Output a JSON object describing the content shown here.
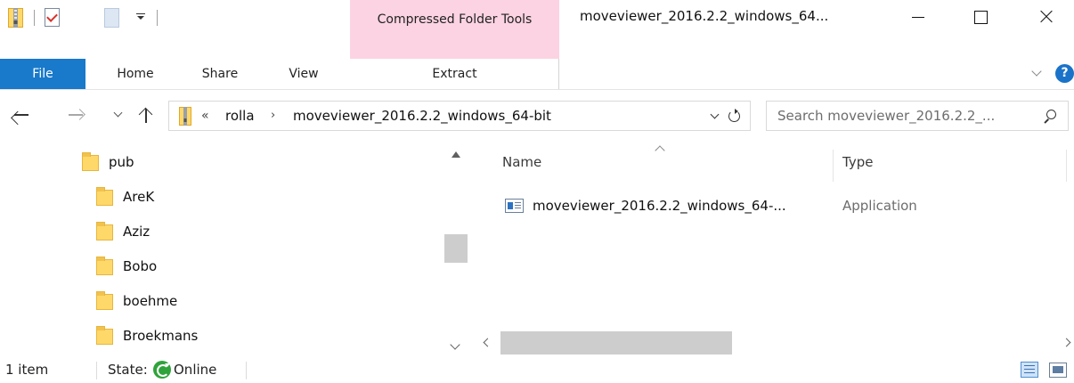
{
  "window": {
    "title": "moveviewer_2016.2.2_windows_64...",
    "context_tab_group": "Compressed Folder Tools"
  },
  "ribbon": {
    "tabs": [
      {
        "label": "File",
        "active": true
      },
      {
        "label": "Home"
      },
      {
        "label": "Share"
      },
      {
        "label": "View"
      },
      {
        "label": "Extract"
      }
    ],
    "help": "?"
  },
  "address_bar": {
    "overflow_chevron": "«",
    "crumbs": [
      "rolla",
      "moveviewer_2016.2.2_windows_64-bit"
    ],
    "separator": "›"
  },
  "search": {
    "placeholder": "Search moveviewer_2016.2.2_..."
  },
  "navigation_pane": {
    "items": [
      {
        "label": "pub",
        "level": 0
      },
      {
        "label": "AreK",
        "level": 1
      },
      {
        "label": "Aziz",
        "level": 1
      },
      {
        "label": "Bobo",
        "level": 1
      },
      {
        "label": "boehme",
        "level": 1
      },
      {
        "label": "Broekmans",
        "level": 1
      }
    ]
  },
  "file_list": {
    "columns": [
      "Name",
      "Type"
    ],
    "rows": [
      {
        "name": "moveviewer_2016.2.2_windows_64-...",
        "type": "Application",
        "icon": "application-icon"
      }
    ]
  },
  "status_bar": {
    "item_count": "1 item",
    "state_label": "State:",
    "state_value": "Online"
  },
  "colors": {
    "file_tab": "#1979ca",
    "context_tab": "#fcd3e2",
    "online": "#2fa33a"
  }
}
